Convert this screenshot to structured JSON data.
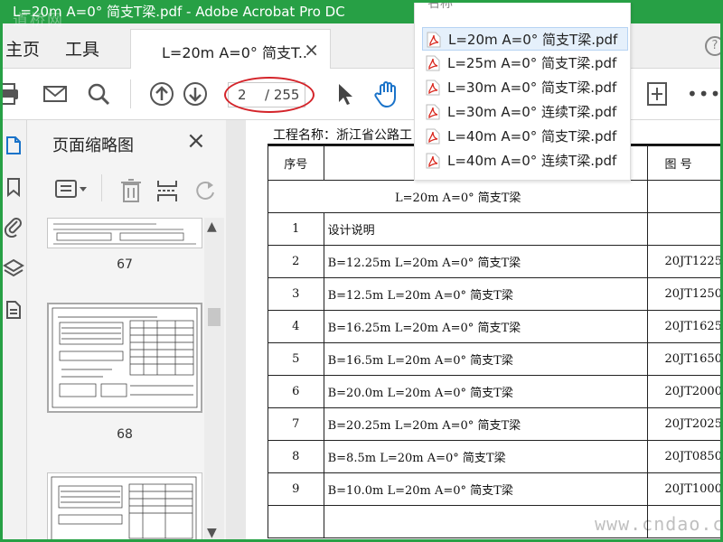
{
  "window": {
    "title": "L=20m A=0° 简支T梁.pdf - Adobe Acrobat Pro DC",
    "watermark_top": "道桥网",
    "watermark_bottom": "www.cndao.com"
  },
  "tabs": {
    "home": "主页",
    "tools": "工具",
    "document": "L=20m A=0° 简支T...",
    "close": "×"
  },
  "toolbar": {
    "page_current": "2",
    "page_total": "/ 255",
    "icons": [
      "print-icon",
      "email-icon",
      "search-icon",
      "page-up-icon",
      "page-down-icon",
      "select-arrow-icon",
      "hand-icon",
      "fit-page-icon",
      "more-icon"
    ],
    "more": "•••"
  },
  "file_dropdown": {
    "header": "名称",
    "items": [
      {
        "name": "L=20m A=0° 简支T梁.pdf",
        "selected": true
      },
      {
        "name": "L=25m A=0° 简支T梁.pdf",
        "selected": false
      },
      {
        "name": "L=30m A=0° 简支T梁.pdf",
        "selected": false
      },
      {
        "name": "L=30m A=0° 连续T梁.pdf",
        "selected": false
      },
      {
        "name": "L=40m A=0° 简支T梁.pdf",
        "selected": false
      },
      {
        "name": "L=40m A=0° 连续T梁.pdf",
        "selected": false
      }
    ]
  },
  "left_rail": {
    "icons": [
      "page-thumbnails-icon",
      "bookmark-icon",
      "attachment-icon",
      "layers-icon",
      "document-properties-icon"
    ]
  },
  "thumbnail_panel": {
    "title": "页面缩略图",
    "close": "×",
    "pages": [
      {
        "number": "67"
      },
      {
        "number": "68"
      },
      {
        "number": ""
      }
    ]
  },
  "document": {
    "project_label": "工程名称：浙江省公路工",
    "table": {
      "header_no": "序号",
      "header_name": "",
      "header_fig": "图  号",
      "section_title": "L=20m A=0°  简支T梁",
      "rows": [
        {
          "no": "1",
          "name": "设计说明",
          "fig": ""
        },
        {
          "no": "2",
          "name": "B=12.25m L=20m A=0°  简支T梁",
          "fig": "20JT1225"
        },
        {
          "no": "3",
          "name": "B=12.5m L=20m A=0°  简支T梁",
          "fig": "20JT1250"
        },
        {
          "no": "4",
          "name": "B=16.25m L=20m A=0°  简支T梁",
          "fig": "20JT1625"
        },
        {
          "no": "5",
          "name": "B=16.5m L=20m A=0°  简支T梁",
          "fig": "20JT1650"
        },
        {
          "no": "6",
          "name": "B=20.0m L=20m A=0°  简支T梁",
          "fig": "20JT2000"
        },
        {
          "no": "7",
          "name": "B=20.25m L=20m A=0°  简支T梁",
          "fig": "20JT2025"
        },
        {
          "no": "8",
          "name": "B=8.5m L=20m A=0°  简支T梁",
          "fig": "20JT0850"
        },
        {
          "no": "9",
          "name": "B=10.0m L=20m A=0°  简支T梁",
          "fig": "20JT1000"
        },
        {
          "no": "",
          "name": "",
          "fig": ""
        }
      ]
    }
  },
  "colors": {
    "titlebar": "#27a045",
    "highlight": "#d4242a",
    "pdf_red": "#d9261c",
    "icon_blue": "#1a73c9"
  }
}
